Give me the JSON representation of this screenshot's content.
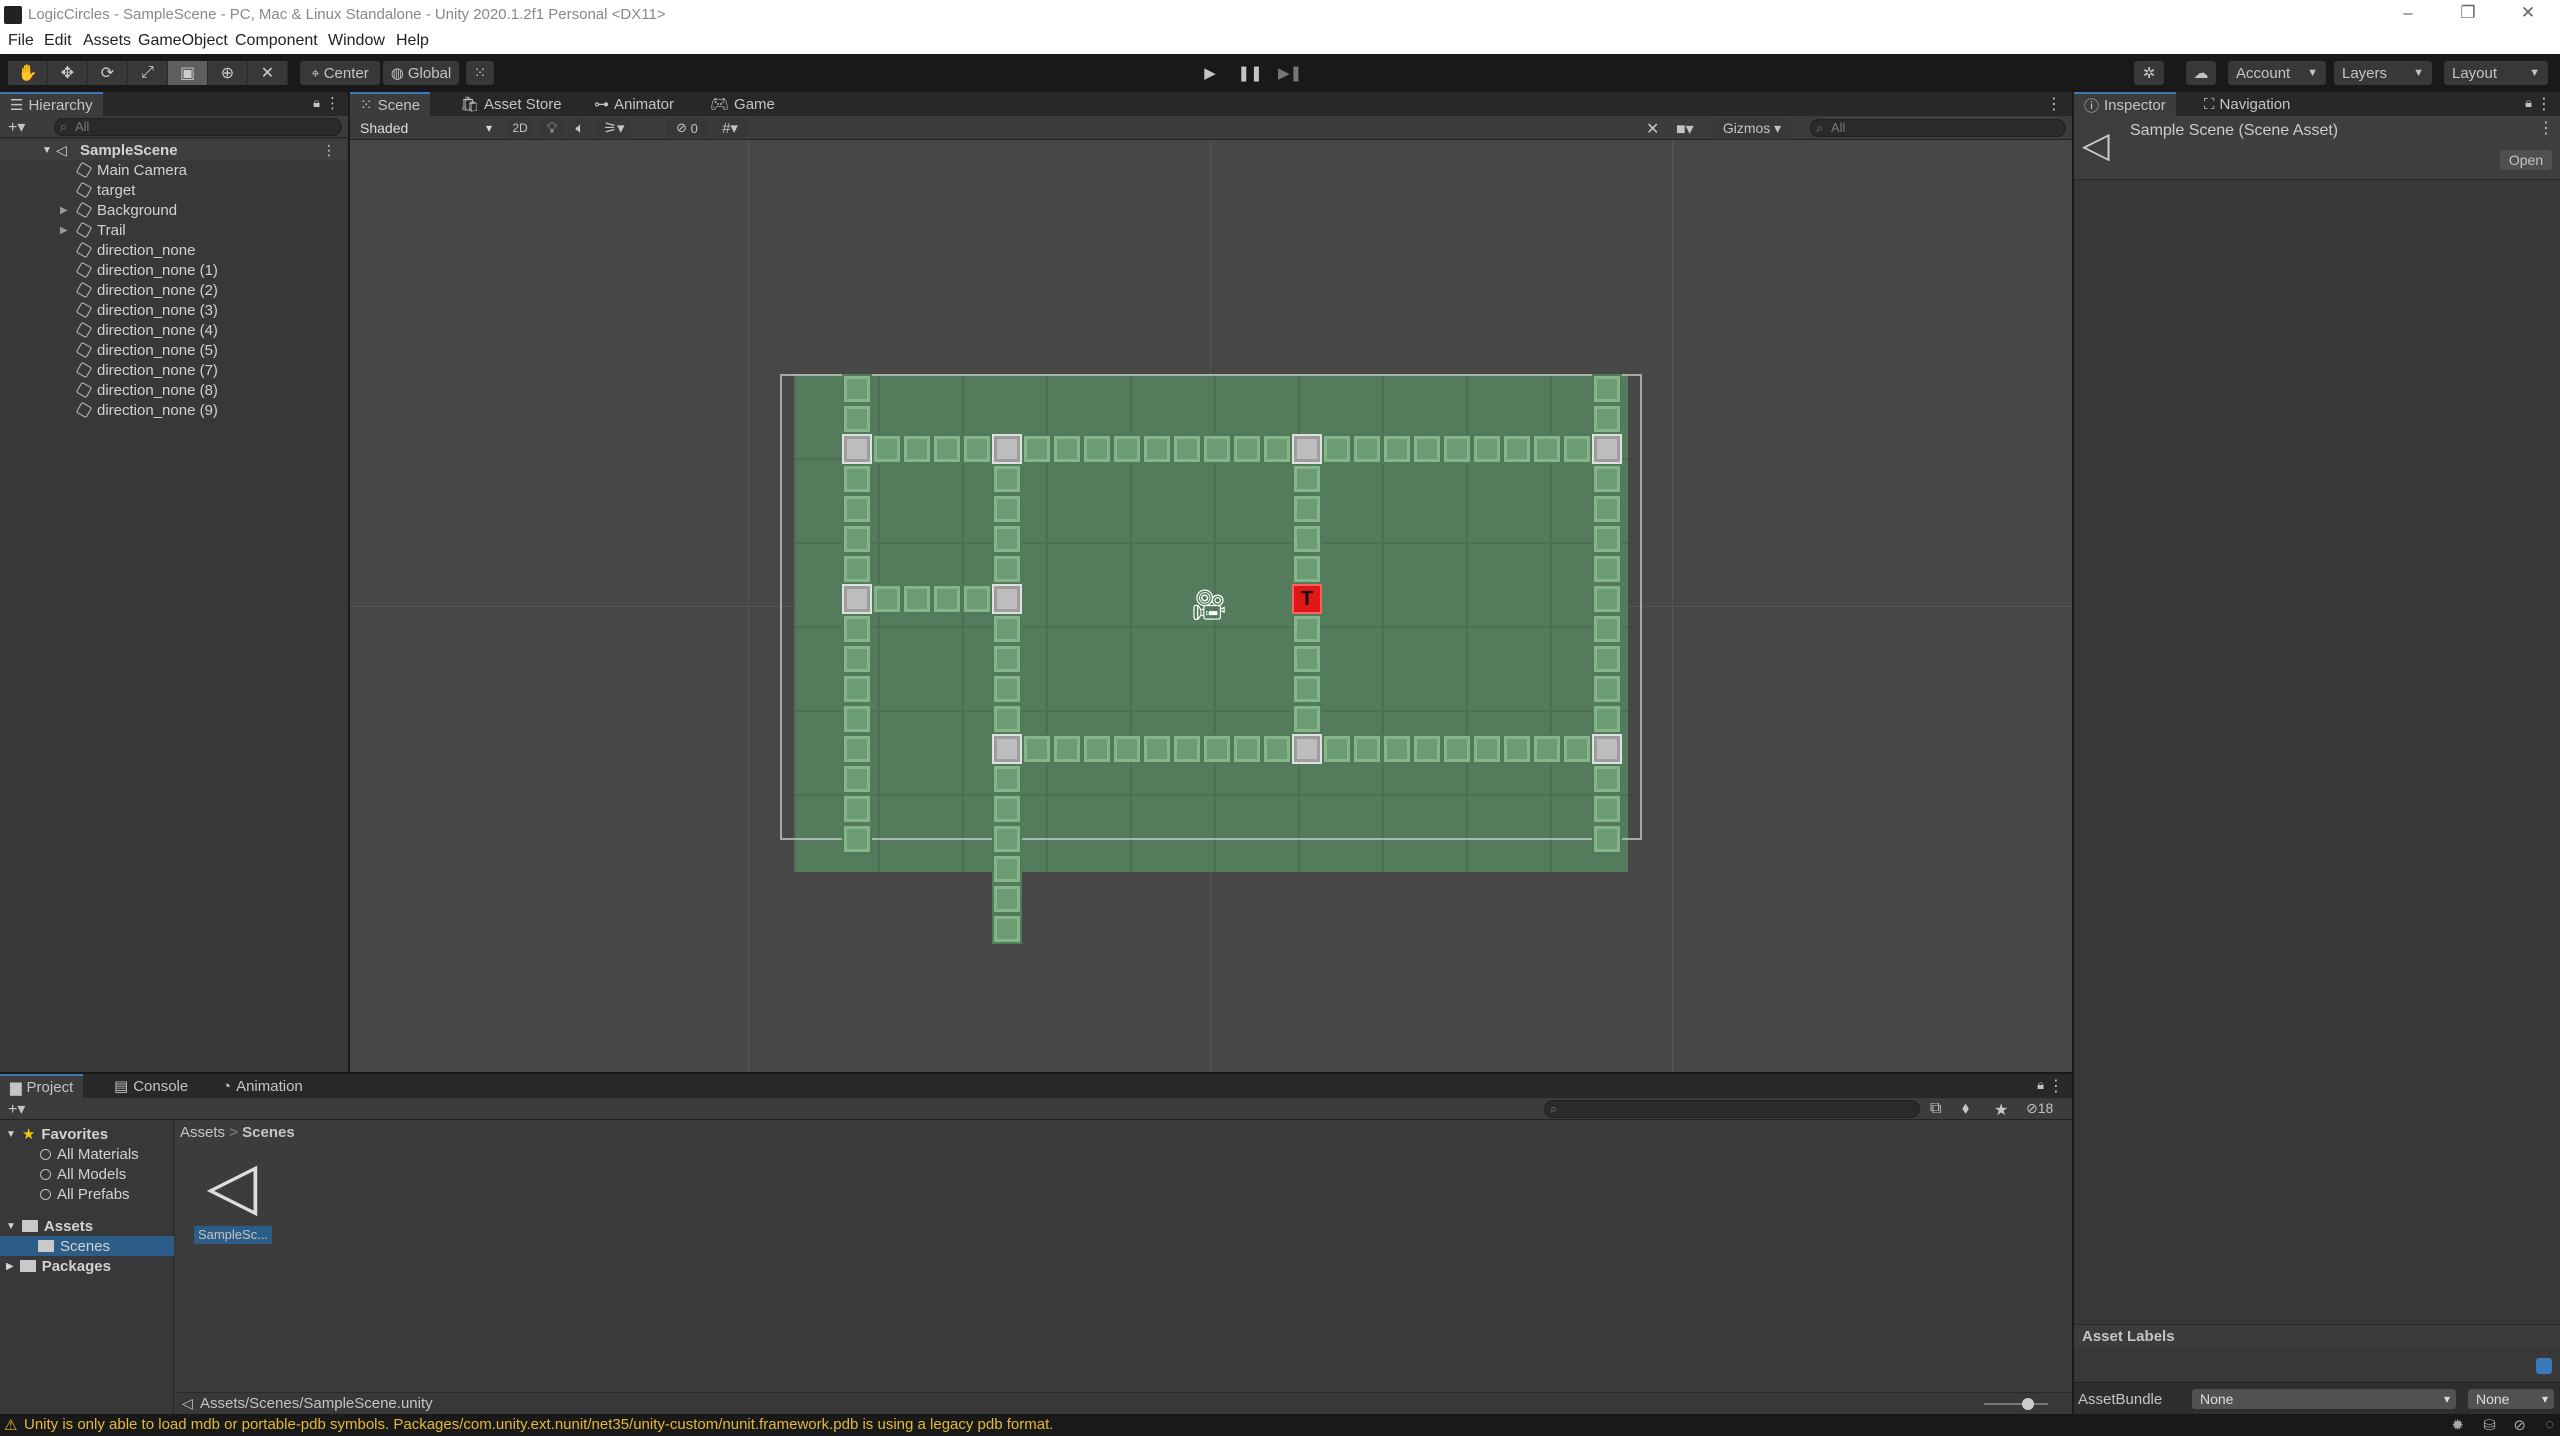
{
  "window": {
    "title": "LogicCircles - SampleScene - PC, Mac & Linux Standalone - Unity 2020.1.2f1 Personal <DX11>"
  },
  "menu": [
    "File",
    "Edit",
    "Assets",
    "GameObject",
    "Component",
    "Window",
    "Help"
  ],
  "toolbar": {
    "pivot_label": "Center",
    "space_label": "Global",
    "account_label": "Account",
    "layers_label": "Layers",
    "layout_label": "Layout"
  },
  "hierarchy": {
    "tab_label": "Hierarchy",
    "search_placeholder": "All",
    "scene_name": "SampleScene",
    "items": [
      {
        "label": "Main Camera",
        "expandable": false
      },
      {
        "label": "target",
        "expandable": false
      },
      {
        "label": "Background",
        "expandable": true
      },
      {
        "label": "Trail",
        "expandable": true
      },
      {
        "label": "direction_none",
        "expandable": false
      },
      {
        "label": "direction_none (1)",
        "expandable": false
      },
      {
        "label": "direction_none (2)",
        "expandable": false
      },
      {
        "label": "direction_none (3)",
        "expandable": false
      },
      {
        "label": "direction_none (4)",
        "expandable": false
      },
      {
        "label": "direction_none (5)",
        "expandable": false
      },
      {
        "label": "direction_none (7)",
        "expandable": false
      },
      {
        "label": "direction_none (8)",
        "expandable": false
      },
      {
        "label": "direction_none (9)",
        "expandable": false
      }
    ]
  },
  "scene": {
    "tabs": [
      "Scene",
      "Asset Store",
      "Animator",
      "Game"
    ],
    "shading_mode": "Shaded",
    "mode_2d_label": "2D",
    "hidden_count": "0",
    "gizmos_label": "Gizmos",
    "search_placeholder": "All",
    "target_marker": "T"
  },
  "inspector": {
    "tabs": [
      "Inspector",
      "Navigation"
    ],
    "asset_title": "Sample Scene (Scene Asset)",
    "open_label": "Open",
    "asset_labels_title": "Asset Labels",
    "assetbundle_label": "AssetBundle",
    "assetbundle_value": "None",
    "assetbundle_variant": "None"
  },
  "project": {
    "tabs": [
      "Project",
      "Console",
      "Animation"
    ],
    "favorites_label": "Favorites",
    "favorites": [
      "All Materials",
      "All Models",
      "All Prefabs"
    ],
    "assets_label": "Assets",
    "assets_children": [
      "Scenes"
    ],
    "packages_label": "Packages",
    "breadcrumb": [
      "Assets",
      "Scenes"
    ],
    "hidden_count": "18",
    "files": [
      {
        "name": "SampleSc..."
      }
    ],
    "selected_path": "Assets/Scenes/SampleScene.unity"
  },
  "status": {
    "message": "Unity is only able to load mdb or portable-pdb symbols. Packages/com.unity.ext.nunit/net35/unity-custom/nunit.framework.pdb is using a legacy pdb format."
  },
  "colors": {
    "accent": "#3a79bb",
    "background_tile": "#6b9c74",
    "target": "#e11616",
    "warning": "#e2b93b"
  }
}
